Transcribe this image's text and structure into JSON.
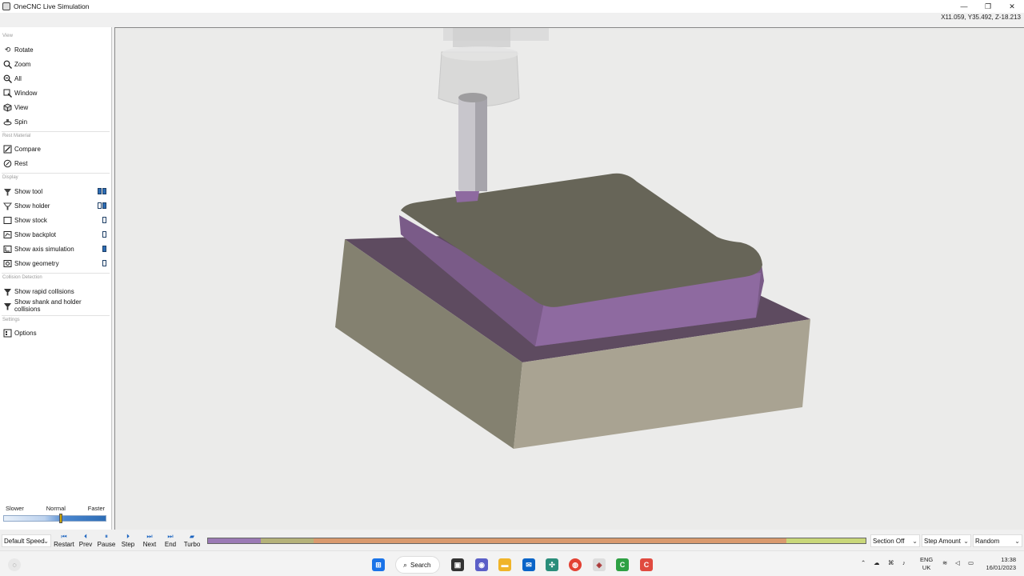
{
  "window": {
    "title": "OneCNC Live Simulation",
    "coords": "X11.059, Y35.492, Z-18.213",
    "minimize": "—",
    "restore": "❐",
    "close": "✕"
  },
  "panel": {
    "groups": {
      "view": "View",
      "rest_material": "Rest Material",
      "display": "Display",
      "collision": "Collision Detection",
      "settings": "Settings"
    },
    "items": {
      "rotate": "Rotate",
      "zoom": "Zoom",
      "all": "All",
      "window": "Window",
      "view": "View",
      "spin": "Spin",
      "compare": "Compare",
      "rest": "Rest",
      "show_tool": "Show tool",
      "show_holder": "Show holder",
      "show_stock": "Show stock",
      "show_backplot": "Show backplot",
      "show_axis": "Show axis simulation",
      "show_geometry": "Show geometry",
      "show_rapid": "Show rapid collisions",
      "show_shank": "Show shank and holder collisions",
      "options": "Options"
    },
    "toggles": {
      "show_tool": [
        true,
        true
      ],
      "show_holder": [
        false,
        true
      ],
      "show_stock": [
        false
      ],
      "show_backplot": [
        false
      ],
      "show_axis": [
        true
      ],
      "show_geometry": [
        false
      ]
    },
    "speed": {
      "slower": "Slower",
      "normal": "Normal",
      "faster": "Faster",
      "level": 0.55
    }
  },
  "controls": {
    "speed_select": "Default Speed",
    "buttons": {
      "restart": "Restart",
      "prev": "Prev",
      "pause": "Pause",
      "step": "Step",
      "next": "Next",
      "end": "End",
      "turbo": "Turbo"
    },
    "section": "Section Off",
    "step_amount": "Step Amount",
    "random": "Random",
    "progress_colors": [
      "#9b7ab5",
      "#b5b27a",
      "#d99a6e",
      "#c9d77a"
    ]
  },
  "taskbar": {
    "search": "Search",
    "lang_top": "ENG",
    "lang_bottom": "UK",
    "time": "13:38",
    "date": "16/01/2023"
  }
}
